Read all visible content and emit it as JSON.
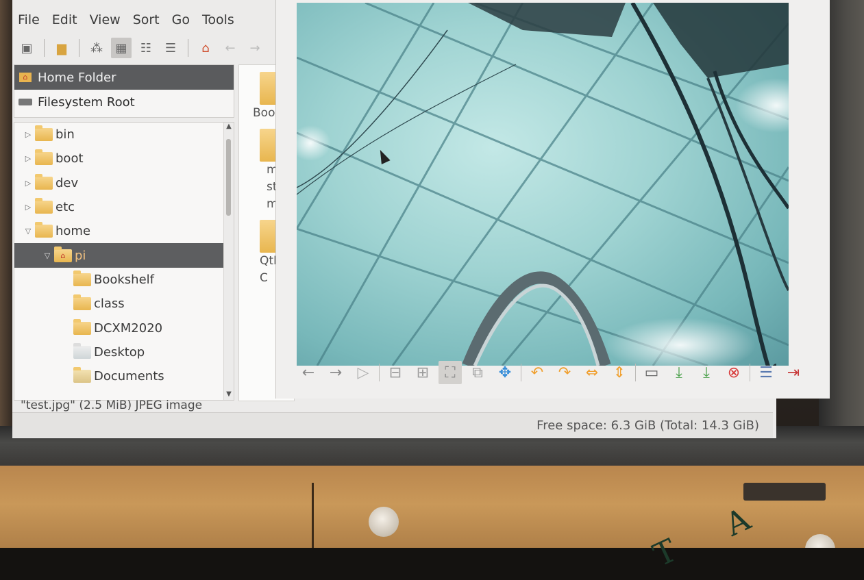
{
  "menu": [
    "File",
    "Edit",
    "View",
    "Sort",
    "Go",
    "Tools"
  ],
  "places": [
    {
      "label": "Home Folder",
      "icon": "home-icon",
      "selected": true
    },
    {
      "label": "Filesystem Root",
      "icon": "drive-icon",
      "selected": false
    }
  ],
  "tree": [
    {
      "label": "bin",
      "expander": "▷",
      "indent": 0,
      "icon": "folder-icon"
    },
    {
      "label": "boot",
      "expander": "▷",
      "indent": 0,
      "icon": "folder-icon"
    },
    {
      "label": "dev",
      "expander": "▷",
      "indent": 0,
      "icon": "folder-icon"
    },
    {
      "label": "etc",
      "expander": "▷",
      "indent": 0,
      "icon": "folder-icon"
    },
    {
      "label": "home",
      "expander": "▽",
      "indent": 0,
      "icon": "folder-icon"
    },
    {
      "label": "pi",
      "expander": "▽",
      "indent": 1,
      "icon": "home-folder-icon",
      "selected": true
    },
    {
      "label": "Bookshelf",
      "expander": "",
      "indent": 2,
      "icon": "folder-icon"
    },
    {
      "label": "class",
      "expander": "",
      "indent": 2,
      "icon": "folder-icon"
    },
    {
      "label": "DCXM2020",
      "expander": "",
      "indent": 2,
      "icon": "folder-icon"
    },
    {
      "label": "Desktop",
      "expander": "",
      "indent": 2,
      "icon": "desktop-folder-icon"
    },
    {
      "label": "Documents",
      "expander": "",
      "indent": 2,
      "icon": "documents-folder-icon"
    }
  ],
  "files": [
    {
      "label": "Boo"
    },
    {
      "label": "m stre ma"
    },
    {
      "label": "QtRa C"
    }
  ],
  "status": "\"test.jpg\" (2.5 MiB) JPEG image",
  "free_space": "Free space: 6.3 GiB (Total: 14.3 GiB)",
  "viewer_tools": [
    {
      "icon": "back-arrow-icon",
      "glyph": "←",
      "color": "#8a8a8a"
    },
    {
      "icon": "forward-arrow-icon",
      "glyph": "→",
      "color": "#8a8a8a"
    },
    {
      "icon": "slideshow-icon",
      "glyph": "▷",
      "color": "#b0b0b0"
    },
    {
      "icon": "zoom-out-icon",
      "glyph": "⊟",
      "color": "#9a9a9a"
    },
    {
      "icon": "zoom-in-icon",
      "glyph": "⊞",
      "color": "#9a9a9a"
    },
    {
      "icon": "fit-window-icon",
      "glyph": "⛶",
      "color": "#8a8a8a"
    },
    {
      "icon": "original-size-icon",
      "glyph": "⧉",
      "color": "#9a9a9a"
    },
    {
      "icon": "fullscreen-icon",
      "glyph": "✥",
      "color": "#3a8fd9"
    },
    {
      "icon": "rotate-left-icon",
      "glyph": "↶",
      "color": "#f0a030"
    },
    {
      "icon": "rotate-right-icon",
      "glyph": "↷",
      "color": "#f0a030"
    },
    {
      "icon": "flip-horizontal-icon",
      "glyph": "⇔",
      "color": "#f0a030"
    },
    {
      "icon": "flip-vertical-icon",
      "glyph": "⇕",
      "color": "#f0a030"
    },
    {
      "icon": "open-file-icon",
      "glyph": "▭",
      "color": "#666"
    },
    {
      "icon": "save-icon",
      "glyph": "⤓",
      "color": "#4aa04a"
    },
    {
      "icon": "save-as-icon",
      "glyph": "⤓",
      "color": "#4aa04a"
    },
    {
      "icon": "delete-icon",
      "glyph": "⊗",
      "color": "#d83a3a"
    },
    {
      "icon": "preferences-icon",
      "glyph": "☰",
      "color": "#5a7ab0"
    },
    {
      "icon": "quit-icon",
      "glyph": "⇥",
      "color": "#c83a3a"
    }
  ]
}
